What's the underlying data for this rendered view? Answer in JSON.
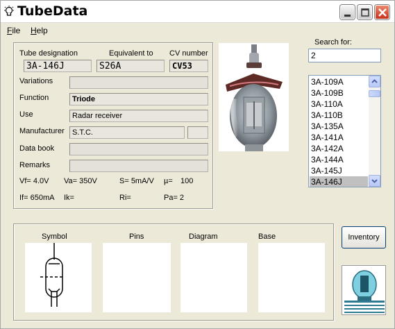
{
  "window": {
    "title": "TubeData"
  },
  "menu": {
    "file": "File",
    "help": "Help"
  },
  "header": {
    "designation_label": "Tube designation",
    "equivalent_label": "Equivalent to",
    "cv_label": "CV number"
  },
  "values": {
    "designation": "3A-146J",
    "equivalent": "S26A",
    "cv": "CV53",
    "variations": "",
    "function": "Triode",
    "use": "Radar receiver",
    "manufacturer": "S.T.C.",
    "manufacturer_code": "",
    "data_book": "",
    "remarks": ""
  },
  "labels": {
    "variations": "Variations",
    "function": "Function",
    "use": "Use",
    "manufacturer": "Manufacturer",
    "data_book": "Data book",
    "remarks": "Remarks"
  },
  "specs": {
    "vf": "Vf= 4.0V",
    "va": "Va= 350V",
    "s": "S= 5mA/V",
    "mu": "µ=",
    "mu_val": "100",
    "if": "If= 650mA",
    "ik": "Ik=",
    "ri": "Ri=",
    "pa": "Pa= 2"
  },
  "search": {
    "label": "Search for:",
    "value": "2"
  },
  "list": {
    "items": [
      "3A-109A",
      "3A-109B",
      "3A-110A",
      "3A-110B",
      "3A-135A",
      "3A-141A",
      "3A-142A",
      "3A-144A",
      "3A-145J",
      "3A-146J"
    ],
    "selected": "3A-146J"
  },
  "bottom": {
    "symbol": "Symbol",
    "pins": "Pins",
    "diagram": "Diagram",
    "base": "Base"
  },
  "buttons": {
    "inventory": "Inventory"
  },
  "icons": {
    "app": "lightbulb-icon",
    "minimize": "minimize-icon",
    "maximize": "maximize-icon",
    "close": "close-icon",
    "scroll_up": "arrow-up-icon",
    "scroll_down": "arrow-down-icon"
  }
}
